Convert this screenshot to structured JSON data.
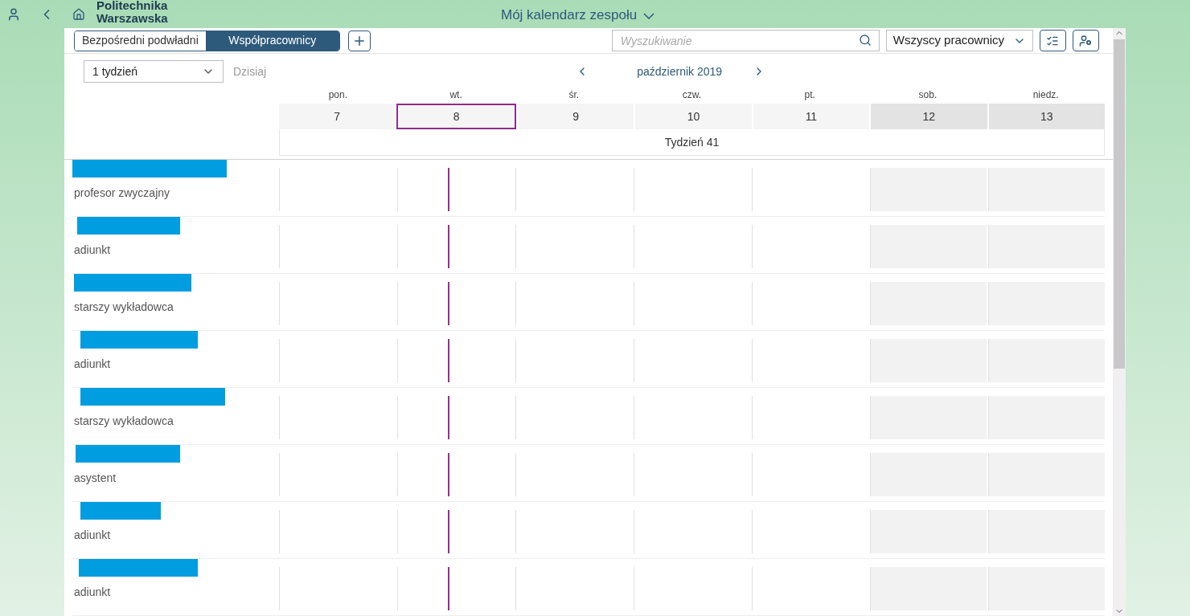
{
  "shell": {
    "logo": [
      "Politechnika",
      "Warszawska"
    ],
    "title": "Mój kalendarz zespołu"
  },
  "tabs": [
    {
      "label": "Bezpośredni podwładni",
      "selected": false
    },
    {
      "label": "Współpracownicy",
      "selected": true
    }
  ],
  "search": {
    "placeholder": "Wyszukiwanie"
  },
  "filter": {
    "value": "Wszyscy pracownicy"
  },
  "period": {
    "value": "1 tydzień"
  },
  "today_button": "Dzisiaj",
  "month": "październik 2019",
  "days": [
    {
      "weekday": "pon.",
      "date": "7",
      "weekend": false,
      "today": false
    },
    {
      "weekday": "wt.",
      "date": "8",
      "weekend": false,
      "today": true
    },
    {
      "weekday": "śr.",
      "date": "9",
      "weekend": false,
      "today": false
    },
    {
      "weekday": "czw.",
      "date": "10",
      "weekend": false,
      "today": false
    },
    {
      "weekday": "pt.",
      "date": "11",
      "weekend": false,
      "today": false
    },
    {
      "weekday": "sob.",
      "date": "12",
      "weekend": true,
      "today": false
    },
    {
      "weekday": "niedz.",
      "date": "13",
      "weekend": true,
      "today": false
    }
  ],
  "week_label": "Tydzień 41",
  "employees": [
    {
      "role": "profesor zwyczajny"
    },
    {
      "role": "adiunkt"
    },
    {
      "role": "starszy wykładowca"
    },
    {
      "role": "adiunkt"
    },
    {
      "role": "starszy wykładowca"
    },
    {
      "role": "asystent"
    },
    {
      "role": "adiunkt"
    },
    {
      "role": "adiunkt"
    }
  ]
}
